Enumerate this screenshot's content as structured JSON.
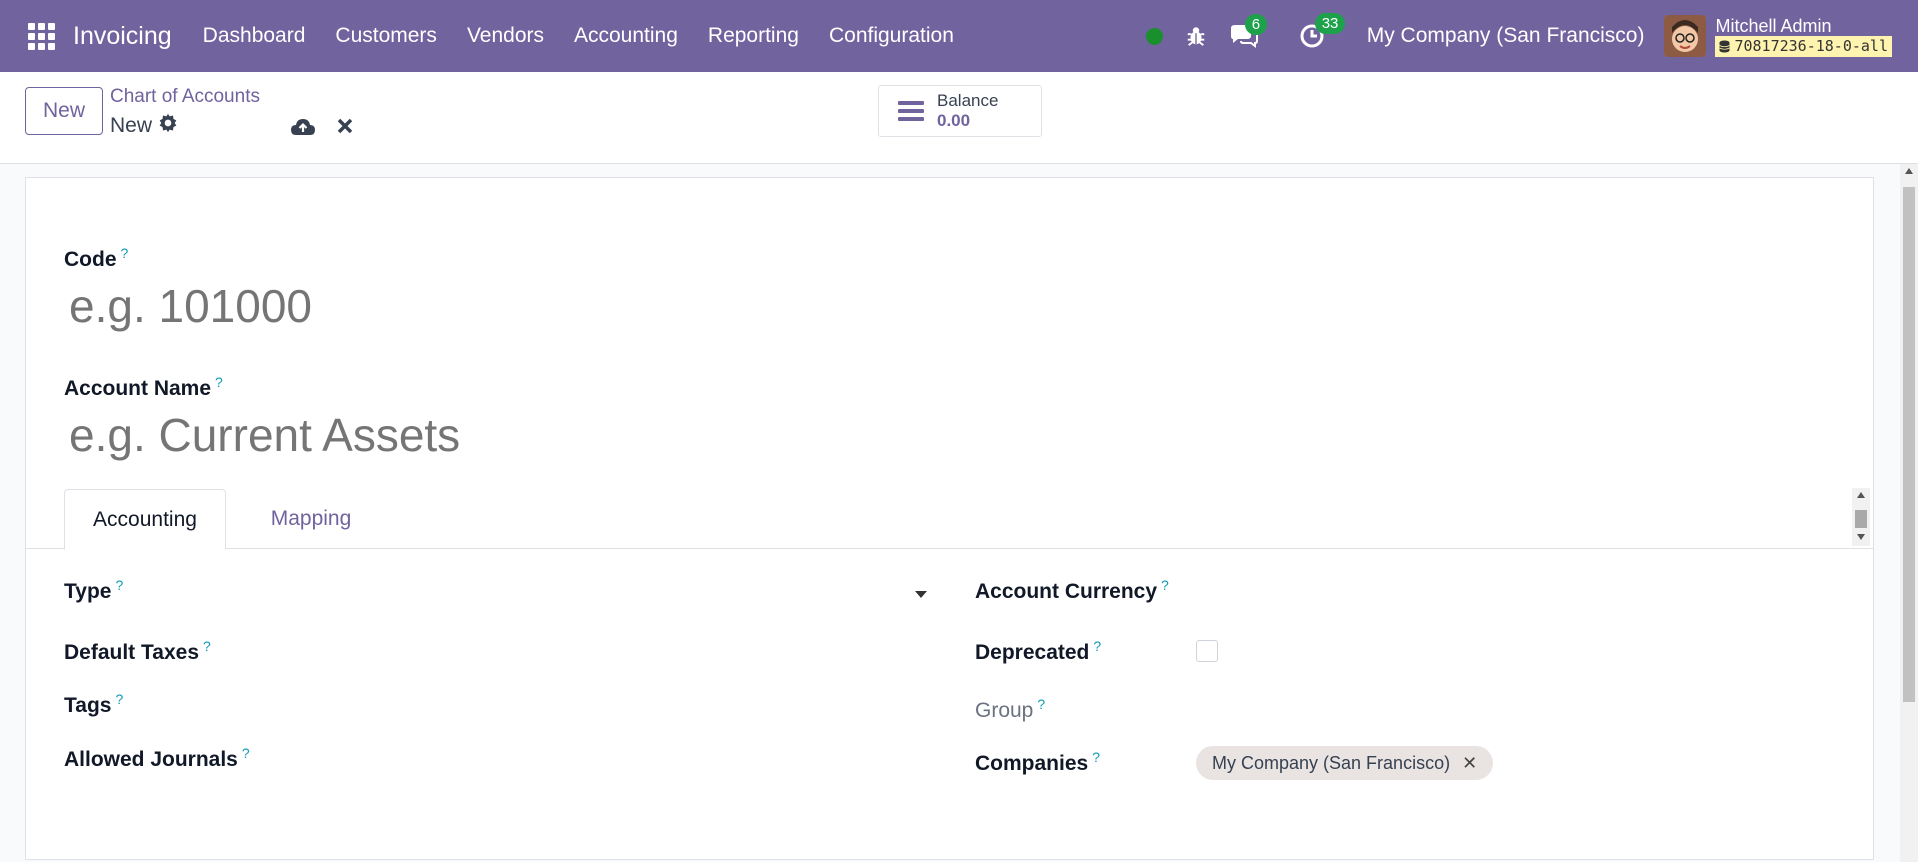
{
  "navbar": {
    "brand": "Invoicing",
    "menu": [
      "Dashboard",
      "Customers",
      "Vendors",
      "Accounting",
      "Reporting",
      "Configuration"
    ],
    "messages_count": "6",
    "activities_count": "33",
    "company": "My Company (San Francisco)",
    "user_name": "Mitchell Admin",
    "db_name": "70817236-18-0-all"
  },
  "control": {
    "new_button": "New",
    "breadcrumb": "Chart of Accounts",
    "record_name": "New",
    "balance_label": "Balance",
    "balance_value": "0.00"
  },
  "form": {
    "code_label": "Code",
    "code_placeholder": "e.g. 101000",
    "name_label": "Account Name",
    "name_placeholder": "e.g. Current Assets",
    "tabs": [
      "Accounting",
      "Mapping"
    ],
    "help_mark": "?",
    "left_fields": [
      "Type",
      "Default Taxes",
      "Tags",
      "Allowed Journals"
    ],
    "right_fields": [
      "Account Currency",
      "Deprecated",
      "Group",
      "Companies"
    ],
    "companies_tag": "My Company (San Francisco)"
  },
  "colors": {
    "navbar": "#71639e",
    "accent": "#71639e",
    "help": "#0d9bb5",
    "badge": "#1ea14b"
  }
}
